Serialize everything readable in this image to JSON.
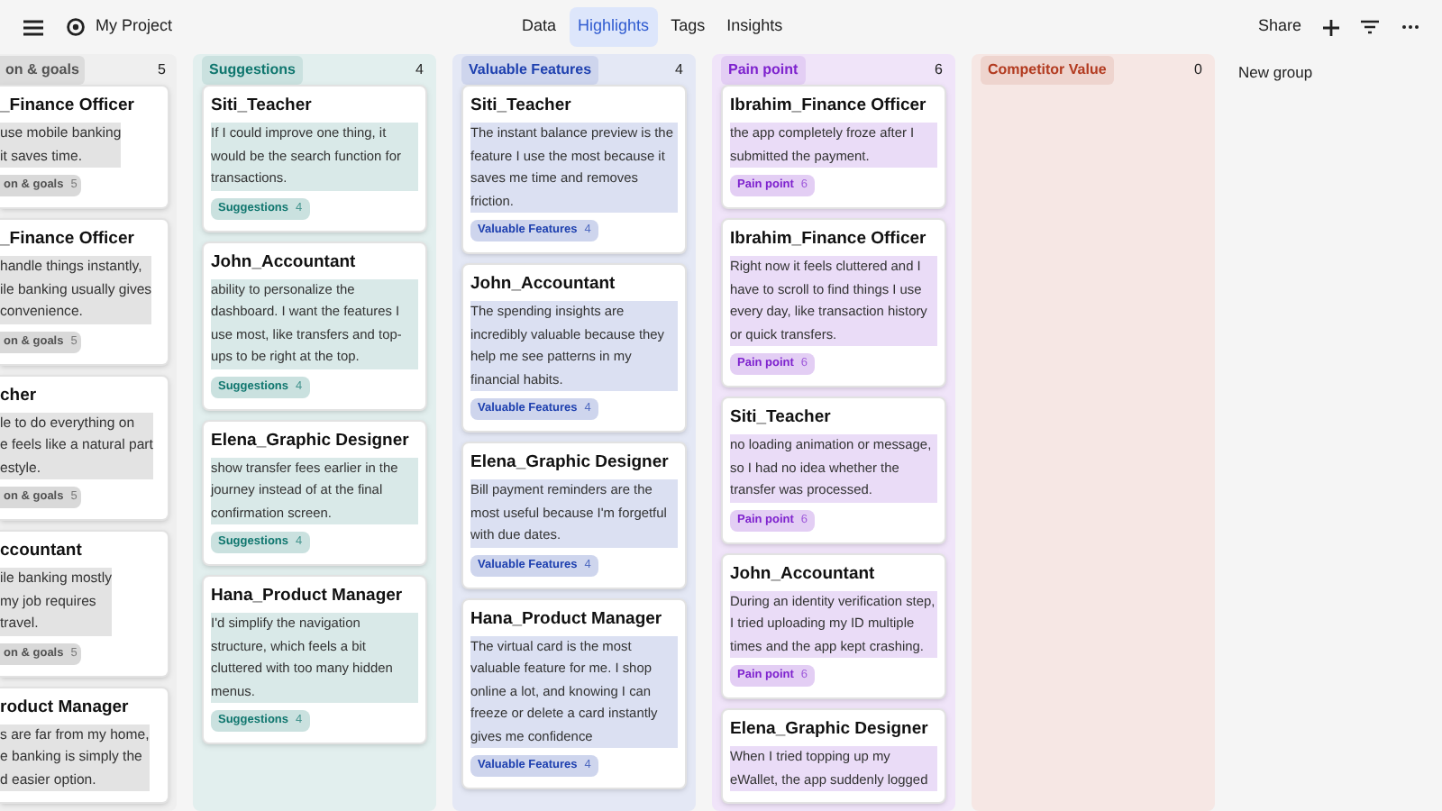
{
  "project": {
    "title": "My Project"
  },
  "tabs": [
    {
      "label": "Data",
      "selected": false
    },
    {
      "label": "Highlights",
      "selected": true
    },
    {
      "label": "Tags",
      "selected": false
    },
    {
      "label": "Insights",
      "selected": false
    }
  ],
  "actions": {
    "share": "Share"
  },
  "groups": [
    {
      "kind": "cut",
      "name": "on & goals",
      "count": "5",
      "color": "#525252",
      "cards": [
        {
          "author": "_Finance Officer",
          "text": "use mobile banking\nit saves time.",
          "tag": "on & goals",
          "tag_count": "5"
        },
        {
          "author": "_Finance Officer",
          "text": "handle things instantly,\nile banking usually gives\nconvenience.",
          "tag": "on & goals",
          "tag_count": "5"
        },
        {
          "author": "cher",
          "text": "le to do everything on\ne feels like a natural part\nestyle.",
          "tag": "on & goals",
          "tag_count": "5"
        },
        {
          "author": "ccountant",
          "text": "ile banking mostly\nmy job requires\ntravel.",
          "tag": "on & goals",
          "tag_count": "5"
        },
        {
          "author": "roduct Manager",
          "text": "s are far from my home,\ne banking is simply the\nd easier option."
        }
      ]
    },
    {
      "kind": "full",
      "name": "Suggestions",
      "count": "4",
      "color": "#0f766e",
      "cards": [
        {
          "author": "Siti_Teacher",
          "text": "If I could improve one thing, it would be the search function for transactions.",
          "tag": "Suggestions",
          "tag_count": "4"
        },
        {
          "author": "John_Accountant",
          "text": "ability to personalize the dashboard. I want the features I use most, like transfers and top-ups to be right at the top.",
          "tag": "Suggestions",
          "tag_count": "4"
        },
        {
          "author": "Elena_Graphic Designer",
          "text": "show transfer fees earlier in the journey instead of at the final confirmation screen.",
          "tag": "Suggestions",
          "tag_count": "4"
        },
        {
          "author": "Hana_Product Manager",
          "text": "I'd simplify the navigation structure, which feels a bit cluttered with too many hidden menus.",
          "tag": "Suggestions",
          "tag_count": "4"
        }
      ]
    },
    {
      "kind": "full",
      "name": "Valuable Features",
      "count": "4",
      "color": "#1e40af",
      "cards": [
        {
          "author": "Siti_Teacher",
          "text": "The instant balance preview is the feature I use the most because it saves me time and removes friction.",
          "tag": "Valuable Features",
          "tag_count": "4"
        },
        {
          "author": "John_Accountant",
          "text": "The spending insights are incredibly valuable because they help me see patterns in my financial habits.",
          "tag": "Valuable Features",
          "tag_count": "4"
        },
        {
          "author": "Elena_Graphic Designer",
          "text": "Bill payment reminders are the most useful because I'm forgetful with due dates.",
          "tag": "Valuable Features",
          "tag_count": "4"
        },
        {
          "author": "Hana_Product Manager",
          "text": "The virtual card is the most valuable feature for me. I shop online a lot, and knowing I can freeze or delete a card instantly gives me confidence",
          "tag": "Valuable Features",
          "tag_count": "4"
        }
      ]
    },
    {
      "kind": "full",
      "name": "Pain point",
      "count": "6",
      "color": "#7e22ce",
      "cards": [
        {
          "author": "Ibrahim_Finance Officer",
          "text": "the app completely froze after I submitted the payment.",
          "tag": "Pain point",
          "tag_count": "6"
        },
        {
          "author": "Ibrahim_Finance Officer",
          "text": "Right now it feels cluttered and I have to scroll to find things I use every day, like transaction history or quick transfers.",
          "tag": "Pain point",
          "tag_count": "6"
        },
        {
          "author": "Siti_Teacher",
          "text": "no loading animation or message, so I had no idea whether the transfer was processed.",
          "tag": "Pain point",
          "tag_count": "6"
        },
        {
          "author": "John_Accountant",
          "text": "During an identity verification step, I tried uploading my ID multiple times and the app kept crashing.",
          "tag": "Pain point",
          "tag_count": "6"
        },
        {
          "author": "Elena_Graphic Designer",
          "text": "When I tried topping up my eWallet, the app suddenly logged"
        }
      ]
    },
    {
      "kind": "full",
      "name": "Competitor Value",
      "count": "0",
      "color": "#b23a1f"
    }
  ],
  "new_group": "New group"
}
